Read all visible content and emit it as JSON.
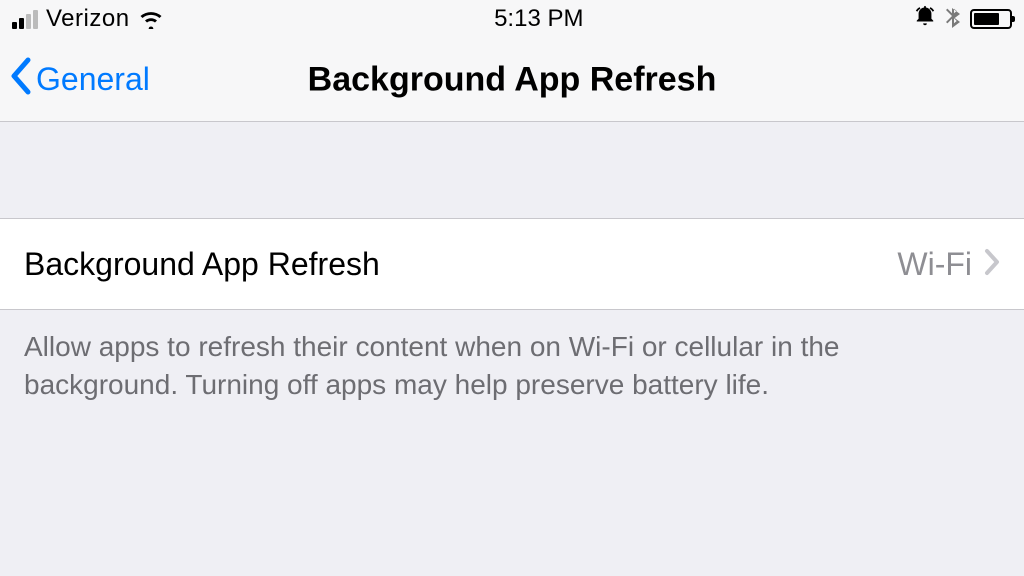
{
  "status": {
    "carrier": "Verizon",
    "time": "5:13 PM"
  },
  "nav": {
    "back_label": "General",
    "title": "Background App Refresh"
  },
  "row": {
    "label": "Background App Refresh",
    "value": "Wi-Fi"
  },
  "footer": "Allow apps to refresh their content when on Wi-Fi or cellular in the background. Turning off apps may help preserve battery life."
}
